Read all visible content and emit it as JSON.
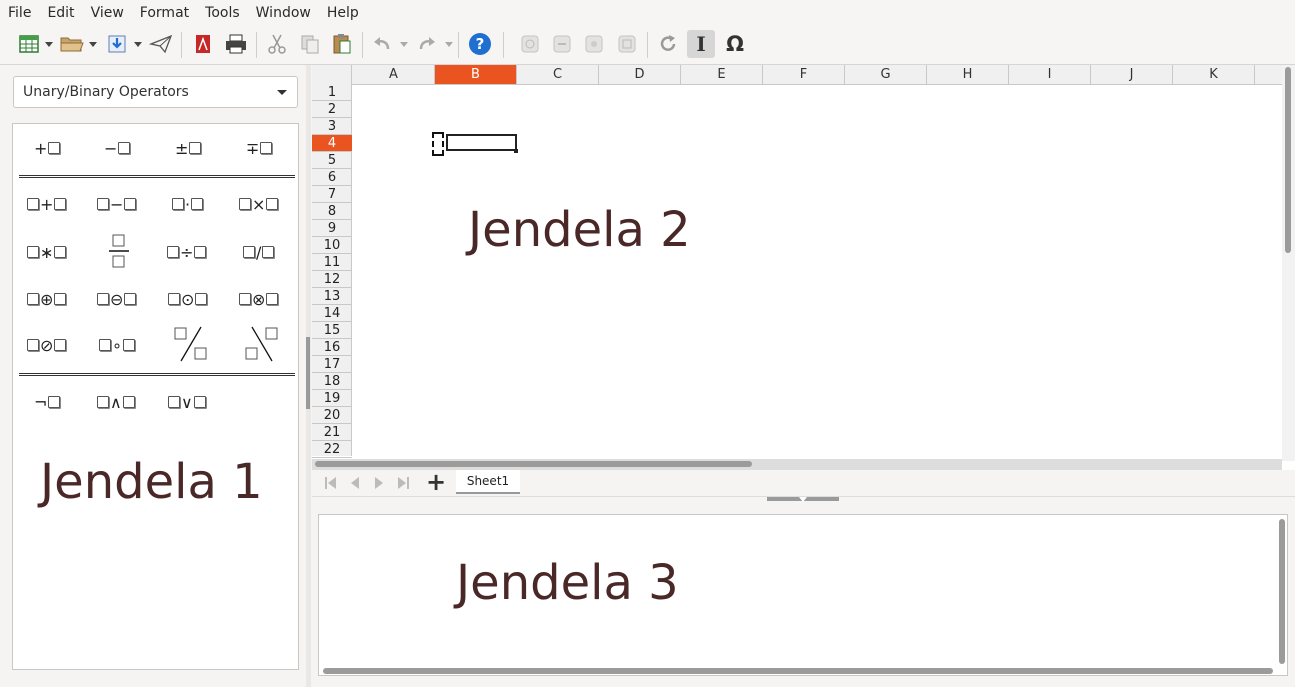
{
  "menubar": {
    "items": [
      "File",
      "Edit",
      "View",
      "Format",
      "Tools",
      "Window",
      "Help"
    ]
  },
  "toolbar": {
    "icons": [
      "new-document-icon",
      "open-folder-icon",
      "save-icon",
      "send-icon",
      "export-pdf-icon",
      "print-icon",
      "cut-icon",
      "copy-icon",
      "paste-icon",
      "undo-icon",
      "redo-icon",
      "help-icon",
      "zoom-in-icon",
      "zoom-out-icon",
      "zoom-100-icon",
      "show-all-icon",
      "update-icon",
      "formula-cursor-icon",
      "symbols-icon"
    ],
    "help_glyph": "?",
    "formula_cursor_glyph": "I",
    "symbols_glyph": "Ω"
  },
  "elements_panel": {
    "category": "Unary/Binary Operators",
    "unary_row": [
      {
        "left": "+",
        "right": ""
      },
      {
        "left": "−",
        "right": ""
      },
      {
        "left": "±",
        "right": ""
      },
      {
        "left": "∓",
        "right": ""
      }
    ],
    "binary_rows": [
      [
        "+",
        "−",
        "·",
        "×"
      ],
      [
        "∗",
        "frac",
        "÷",
        "/"
      ],
      [
        "⊕",
        "⊖",
        "⊙",
        "⊗"
      ],
      [
        "⊘",
        "∘",
        "wideslash",
        "widebslash"
      ]
    ],
    "logic_row": [
      "¬",
      "∧",
      "∨"
    ],
    "overlay_label": "Jendela 1"
  },
  "spreadsheet": {
    "columns": [
      "A",
      "B",
      "C",
      "D",
      "E",
      "F",
      "G",
      "H",
      "I",
      "J",
      "K"
    ],
    "selected_column": "B",
    "rows": [
      "1",
      "2",
      "3",
      "4",
      "5",
      "6",
      "7",
      "8",
      "9",
      "10",
      "11",
      "12",
      "13",
      "14",
      "15",
      "16",
      "17",
      "18",
      "19",
      "20",
      "21",
      "22"
    ],
    "selected_row": "4",
    "overlay_label": "Jendela 2"
  },
  "tabs": {
    "sheet_name": "Sheet1",
    "add_glyph": "+"
  },
  "edit_pane": {
    "overlay_label": "Jendela 3"
  },
  "colors": {
    "accent": "#e95420",
    "overlay_text": "#4a2828"
  }
}
